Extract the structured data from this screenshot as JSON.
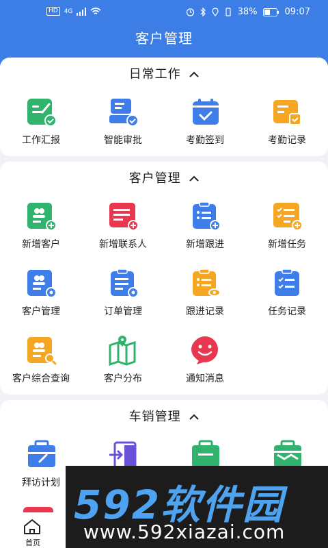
{
  "status_bar": {
    "left_badge_hd": "HD",
    "left_badge_net": "4G",
    "battery_percent": "38%",
    "time": "09:07"
  },
  "header": {
    "title": "客户管理"
  },
  "sections": [
    {
      "title": "日常工作",
      "items": [
        {
          "label": "工作汇报",
          "icon": "work-report-icon",
          "color": "#2fb36d"
        },
        {
          "label": "智能审批",
          "icon": "smart-approval-icon",
          "color": "#3f7de8"
        },
        {
          "label": "考勤签到",
          "icon": "attendance-checkin-icon",
          "color": "#3f7de8"
        },
        {
          "label": "考勤记录",
          "icon": "attendance-record-icon",
          "color": "#f5a623"
        }
      ]
    },
    {
      "title": "客户管理",
      "items": [
        {
          "label": "新增客户",
          "icon": "add-customer-icon",
          "color": "#2fb36d"
        },
        {
          "label": "新增联系人",
          "icon": "add-contact-icon",
          "color": "#e8384f"
        },
        {
          "label": "新增跟进",
          "icon": "add-followup-icon",
          "color": "#3f7de8"
        },
        {
          "label": "新增任务",
          "icon": "add-task-icon",
          "color": "#f5a623"
        },
        {
          "label": "客户管理",
          "icon": "customer-manage-icon",
          "color": "#3f7de8"
        },
        {
          "label": "订单管理",
          "icon": "order-manage-icon",
          "color": "#3f7de8"
        },
        {
          "label": "跟进记录",
          "icon": "followup-record-icon",
          "color": "#f5a623"
        },
        {
          "label": "任务记录",
          "icon": "task-record-icon",
          "color": "#3f7de8"
        },
        {
          "label": "客户综合查询",
          "icon": "customer-query-icon",
          "color": "#f5a623"
        },
        {
          "label": "客户分布",
          "icon": "customer-map-icon",
          "color": "#2fb36d"
        },
        {
          "label": "通知消息",
          "icon": "notification-icon",
          "color": "#e8384f"
        }
      ]
    },
    {
      "title": "车销管理",
      "items": [
        {
          "label": "拜访计划",
          "icon": "visit-plan-icon",
          "color": "#3f7de8"
        },
        {
          "label": "",
          "icon": "checkin-icon",
          "color": "#6a4fd8"
        },
        {
          "label": "",
          "icon": "briefcase-icon",
          "color": "#2fb36d"
        },
        {
          "label": "",
          "icon": "route-icon",
          "color": "#2fb36d"
        }
      ]
    }
  ],
  "bottom_nav": {
    "home_label": "首页"
  },
  "watermark": {
    "big": "592软件园",
    "small": "www.592xiazai.com"
  }
}
